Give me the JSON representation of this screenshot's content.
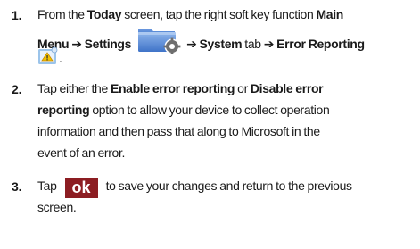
{
  "steps": [
    {
      "number": "1.",
      "line1": {
        "t1": "From the ",
        "b1": "Today",
        "t2": " screen, tap the right soft key function ",
        "b2": "Main"
      },
      "line2": {
        "b1": "Menu",
        "arrow1": "➔",
        "b2": "Settings",
        "arrow2": "➔",
        "b3": "System",
        "t1": " tab ",
        "arrow3": "➔",
        "b4": "Error Reporting"
      },
      "line3": {
        "t1": "."
      },
      "icons": [
        "settings-folder-icon",
        "error-reporting-icon"
      ]
    },
    {
      "number": "2.",
      "line1": {
        "t1": "Tap either the ",
        "b1": "Enable error reporting",
        "t2": " or ",
        "b2": "Disable error"
      },
      "line2": {
        "b1": "reporting",
        "t1": " option to allow your device to collect operation"
      },
      "line3": "information and then pass that along to Microsoft in the",
      "line4": "event of an error."
    },
    {
      "number": "3.",
      "line1": {
        "t1": "Tap ",
        "ok": "ok",
        "t2": " to save your changes and return to the previous"
      },
      "line2": "screen."
    }
  ],
  "colors": {
    "text": "#1a1a1a",
    "ok_badge_bg": "#8c1d22",
    "ok_badge_text": "#ffffff",
    "folder_blue": "#5b8ed6"
  }
}
